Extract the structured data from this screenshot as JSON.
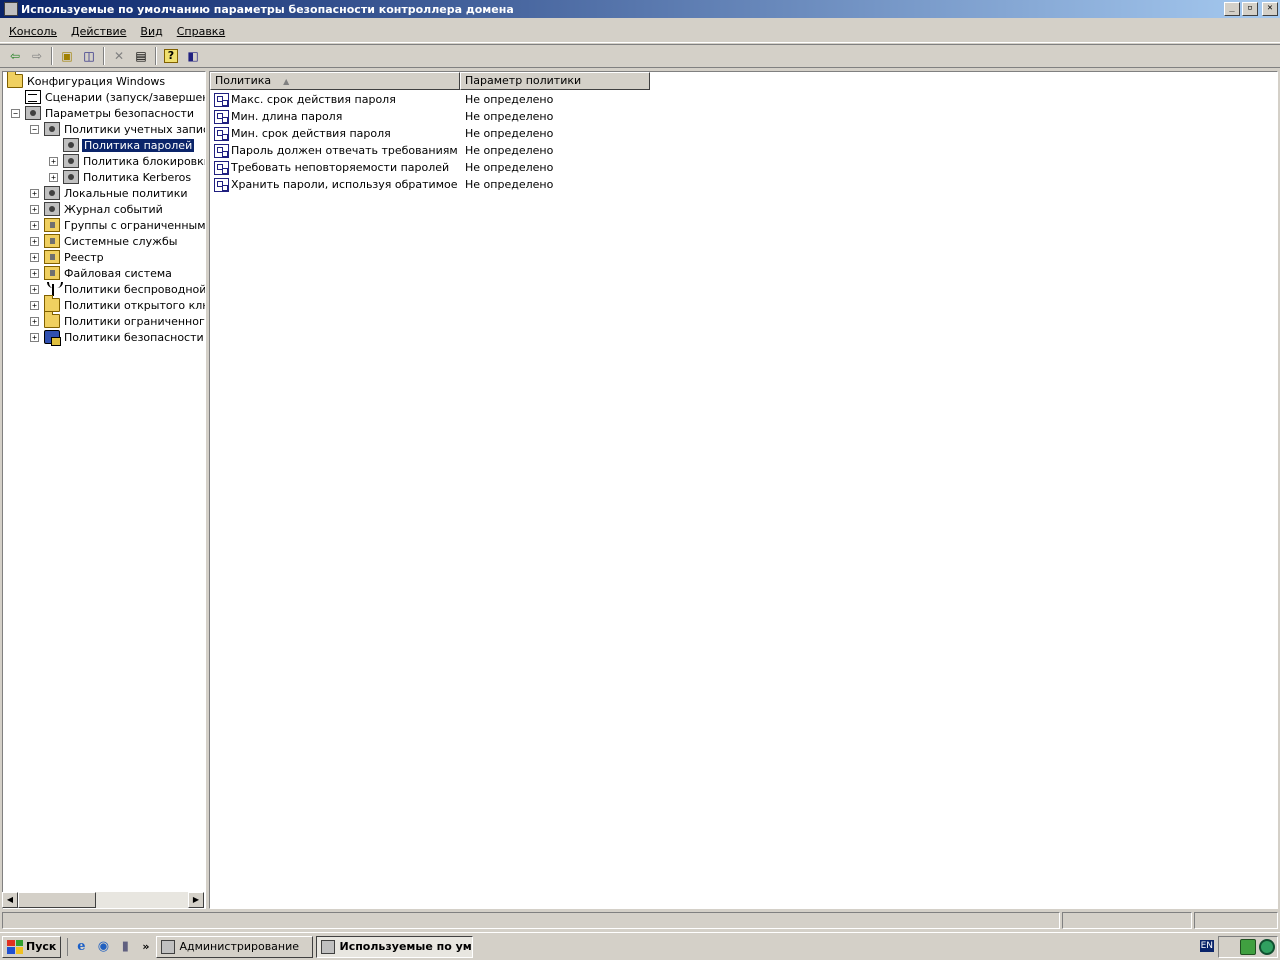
{
  "window": {
    "title": "Используемые по умолчанию параметры безопасности контроллера домена",
    "buttons": {
      "minimize": "_",
      "maximize": "▫",
      "close": "✕"
    }
  },
  "menu": [
    {
      "label": "Консоль"
    },
    {
      "label": "Действие"
    },
    {
      "label": "Вид"
    },
    {
      "label": "Справка"
    }
  ],
  "toolbar": {
    "buttons": [
      {
        "icon": "back-arrow-icon",
        "glyph": "⇦"
      },
      {
        "icon": "forward-arrow-icon",
        "glyph": "⇨"
      },
      {
        "icon": "up-folder-icon",
        "glyph": "▣"
      },
      {
        "icon": "show-hide-tree-icon",
        "glyph": "◫"
      },
      {
        "icon": "delete-icon",
        "glyph": "✕"
      },
      {
        "icon": "export-list-icon",
        "glyph": "▤"
      },
      {
        "icon": "help-icon",
        "glyph": "?"
      },
      {
        "icon": "action-pane-icon",
        "glyph": "◧"
      }
    ]
  },
  "tree": {
    "root": "Конфигурация Windows",
    "items": [
      {
        "label": "Сценарии (запуск/завершение)",
        "expander": "",
        "icon": "script-icon"
      },
      {
        "label": "Параметры безопасности",
        "expander": "−",
        "icon": "gear-icon"
      },
      {
        "label": "Политики учетных записей",
        "expander": "−",
        "icon": "gear-icon"
      },
      {
        "label": "Политика паролей",
        "expander": "",
        "icon": "gear-icon"
      },
      {
        "label": "Политика блокировки учетной записи",
        "expander": "+",
        "icon": "gear-icon"
      },
      {
        "label": "Политика Kerberos",
        "expander": "+",
        "icon": "gear-icon"
      },
      {
        "label": "Локальные политики",
        "expander": "+",
        "icon": "gear-icon"
      },
      {
        "label": "Журнал событий",
        "expander": "+",
        "icon": "gear-icon"
      },
      {
        "label": "Группы с ограниченным доступом",
        "expander": "+",
        "icon": "lockfolder-icon"
      },
      {
        "label": "Системные службы",
        "expander": "+",
        "icon": "lockfolder-icon"
      },
      {
        "label": "Реестр",
        "expander": "+",
        "icon": "lockfolder-icon"
      },
      {
        "label": "Файловая система",
        "expander": "+",
        "icon": "lockfolder-icon"
      },
      {
        "label": "Политики беспроводной сети",
        "expander": "+",
        "icon": "antenna-icon"
      },
      {
        "label": "Политики открытого ключа",
        "expander": "+",
        "icon": "folder-icon"
      },
      {
        "label": "Политики ограниченного использования программ",
        "expander": "+",
        "icon": "folder-icon"
      },
      {
        "label": "Политики безопасности IP на Active Directory",
        "expander": "+",
        "icon": "ipsec-icon"
      }
    ],
    "scroll": {
      "left": "◀",
      "right": "▶"
    }
  },
  "list": {
    "columns": [
      "Политика",
      "Параметр политики"
    ],
    "sort_indicator": "▲",
    "rows": [
      {
        "name": "Макс. срок действия пароля",
        "value": "Не определено"
      },
      {
        "name": "Мин. длина пароля",
        "value": "Не определено"
      },
      {
        "name": "Мин. срок действия пароля",
        "value": "Не определено"
      },
      {
        "name": "Пароль должен отвечать требованиям сл...",
        "value": "Не определено"
      },
      {
        "name": "Требовать неповторяемости паролей",
        "value": "Не определено"
      },
      {
        "name": "Хранить пароли, используя обратимое ши...",
        "value": "Не определено"
      }
    ]
  },
  "taskbar": {
    "start": "Пуск",
    "quicklaunch_more": "»",
    "tasks": [
      {
        "label": "Администрирование"
      },
      {
        "label": "Используемые по ум..."
      }
    ],
    "language": "EN"
  },
  "colors": {
    "titlebar_start": "#0a246a",
    "titlebar_end": "#a6caf0",
    "selection": "#0a246a",
    "face": "#d4d0c8"
  }
}
